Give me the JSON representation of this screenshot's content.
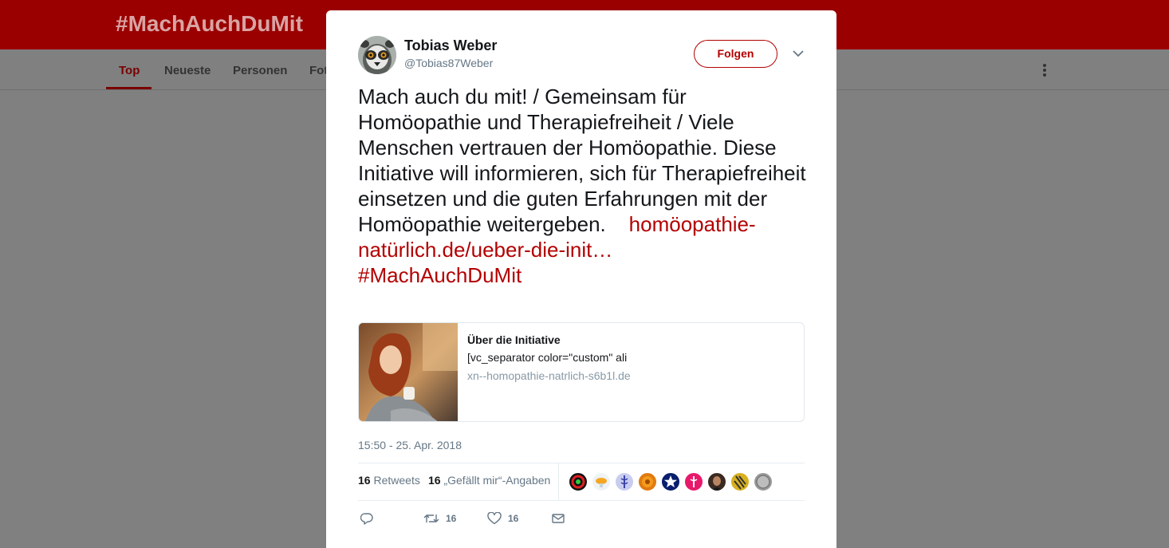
{
  "background": {
    "hashtag": "#MachAuchDuMit",
    "tabs": [
      {
        "label": "Top",
        "active": true
      },
      {
        "label": "Neueste",
        "active": false
      },
      {
        "label": "Personen",
        "active": false
      },
      {
        "label": "Fot",
        "active": false
      }
    ],
    "more_icon": "vertical-dots-icon"
  },
  "tweet": {
    "author_name": "Tobias Weber",
    "author_handle": "@Tobias87Weber",
    "avatar": "lemur-avatar",
    "follow_label": "Folgen",
    "caret_icon": "chevron-down-icon",
    "text": "Mach auch du mit! / Gemeinsam für Homöopathie und Therapiefreiheit / Viele Menschen vertrauen der Homöopathie. Diese Initiative will informieren, sich für Therapiefreiheit einsetzen und die guten Erfahrungen mit der Homöopathie weitergeben.",
    "link": "homöopathie-natürlich.de/ueber-die-init…",
    "hashtag": "#MachAuchDuMit",
    "card": {
      "title": "Über die Initiative",
      "description": "[vc_separator color=\"custom\" ali",
      "domain": "xn--homopathie-natrlich-s6b1l.de"
    },
    "timestamp": "15:50 - 25. Apr. 2018",
    "retweet_count": "16",
    "retweet_label": "Retweets",
    "like_count": "16",
    "like_label": "„Gefällt mir“-Angaben",
    "likers": [
      "liker-avatar-1",
      "liker-avatar-2",
      "liker-avatar-3",
      "liker-avatar-4",
      "liker-avatar-5",
      "liker-avatar-6",
      "liker-avatar-7",
      "liker-avatar-8",
      "liker-avatar-9"
    ],
    "actions": {
      "reply_icon": "reply-icon",
      "retweet_icon": "retweet-icon",
      "retweet_count": "16",
      "like_icon": "heart-icon",
      "like_count": "16",
      "dm_icon": "envelope-icon"
    }
  },
  "colors": {
    "brand": "#9a0000",
    "link": "#b30000",
    "muted": "#657786"
  }
}
